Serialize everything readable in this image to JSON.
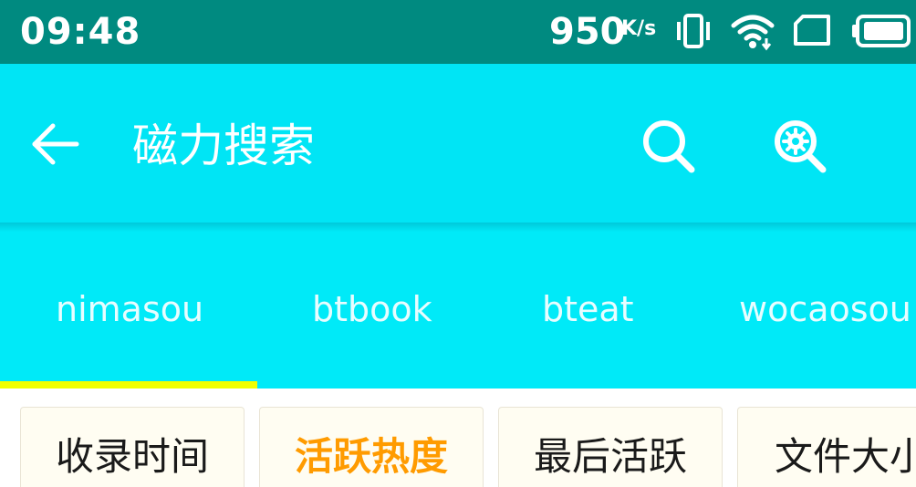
{
  "status_bar": {
    "time": "09:48",
    "network_speed": "950",
    "network_speed_unit": "K/s",
    "icons": [
      "vibrate-icon",
      "wifi-icon",
      "sim-card-icon",
      "battery-icon"
    ]
  },
  "toolbar": {
    "back_icon": "back-arrow-icon",
    "title": "磁力搜索",
    "search_icon": "search-icon",
    "search_settings_icon": "search-settings-icon",
    "background_color": "#00e5f5"
  },
  "tabs": {
    "items": [
      {
        "label": "nimasou",
        "selected": true
      },
      {
        "label": "btbook",
        "selected": false
      },
      {
        "label": "bteat",
        "selected": false
      },
      {
        "label": "wocaosou",
        "selected": false
      }
    ],
    "indicator_color": "#f2ff00"
  },
  "sort_options": {
    "items": [
      {
        "label": "收录时间",
        "selected": false
      },
      {
        "label": "活跃热度",
        "selected": true
      },
      {
        "label": "最后活跃",
        "selected": false
      },
      {
        "label": "文件大小",
        "selected": false
      }
    ],
    "selected_color": "#ff9b00"
  }
}
